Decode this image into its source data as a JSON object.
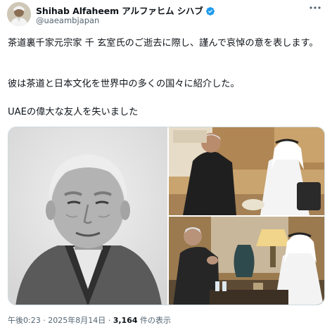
{
  "author": {
    "display_name": "Shihab Alfaheem アルファヒム シハブ",
    "handle": "@uaeambjapan",
    "verified": true
  },
  "icons": {
    "verified": "verified-badge-icon",
    "more": "more-options-icon"
  },
  "colors": {
    "verified_badge": "#1d9bf0",
    "secondary_text": "#536471",
    "primary_text": "#0f1419"
  },
  "tweet": {
    "paragraph_1": "茶道裏千家元宗家 千 玄室氏のご逝去に際し、謹んで哀悼の意を表します。",
    "paragraph_2": "彼は茶道と日本文化を世界中の多くの国々に紹介した。",
    "paragraph_3": "UAEの偉大な友人を失いました"
  },
  "footer": {
    "time": "午後0:23",
    "separator_1": " · ",
    "date": "2025年8月14日",
    "separator_2": " · ",
    "views_count": "3,164",
    "views_label": " 件の表示"
  }
}
